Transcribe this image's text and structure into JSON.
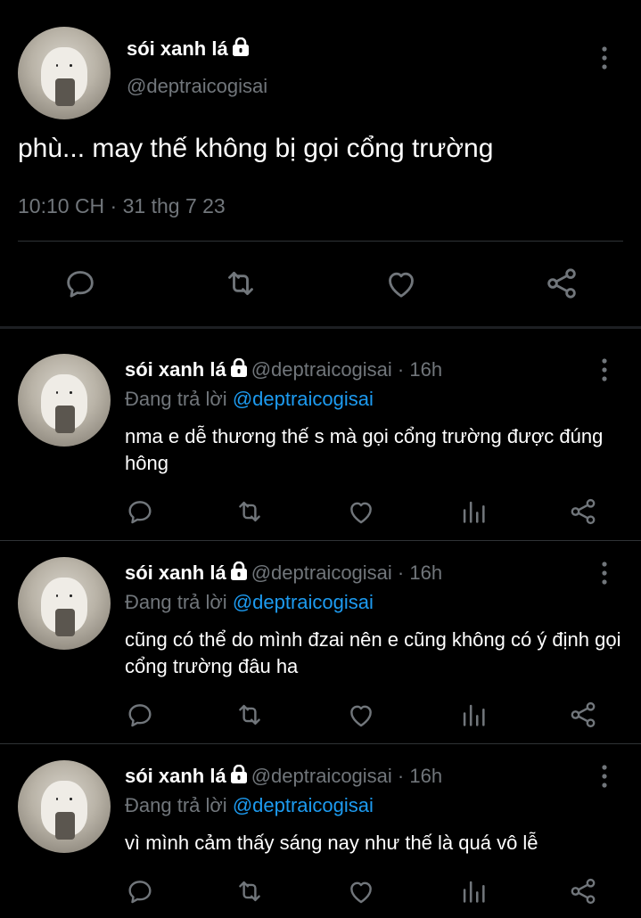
{
  "main_tweet": {
    "display_name": "sói xanh lá",
    "handle": "@deptraicogisai",
    "text": "phù... may thế không bị gọi cổng trường",
    "timestamp": "10:10 CH · 31 thg 7 23",
    "protected_icon": "lock-icon",
    "action_icons": [
      "reply-icon",
      "retweet-icon",
      "like-icon",
      "share-icon"
    ]
  },
  "replies": [
    {
      "display_name": "sói xanh lá",
      "handle_time": "@deptraicogisai · 16h",
      "replying_to_prefix": "Đang trả lời",
      "replying_to_handle": "@deptraicogisai",
      "text": "nma e dễ thương thế s mà gọi cổng trường được đúng hông"
    },
    {
      "display_name": "sói xanh lá",
      "handle_time": "@deptraicogisai · 16h",
      "replying_to_prefix": "Đang trả lời",
      "replying_to_handle": "@deptraicogisai",
      "text": "cũng có thể do mình đzai nên e cũng không có ý định gọi cổng trường đâu ha"
    },
    {
      "display_name": "sói xanh lá",
      "handle_time": "@deptraicogisai · 16h",
      "replying_to_prefix": "Đang trả lời",
      "replying_to_handle": "@deptraicogisai",
      "text": "vì mình cảm thấy sáng nay như thế là quá vô lễ"
    }
  ],
  "reply_action_icons": [
    "reply-icon",
    "retweet-icon",
    "like-icon",
    "analytics-icon",
    "share-icon"
  ],
  "colors": {
    "background": "#000000",
    "text": "#e7e9ea",
    "muted": "#71767b",
    "link": "#1d9bf0",
    "divider": "#2f3336"
  }
}
